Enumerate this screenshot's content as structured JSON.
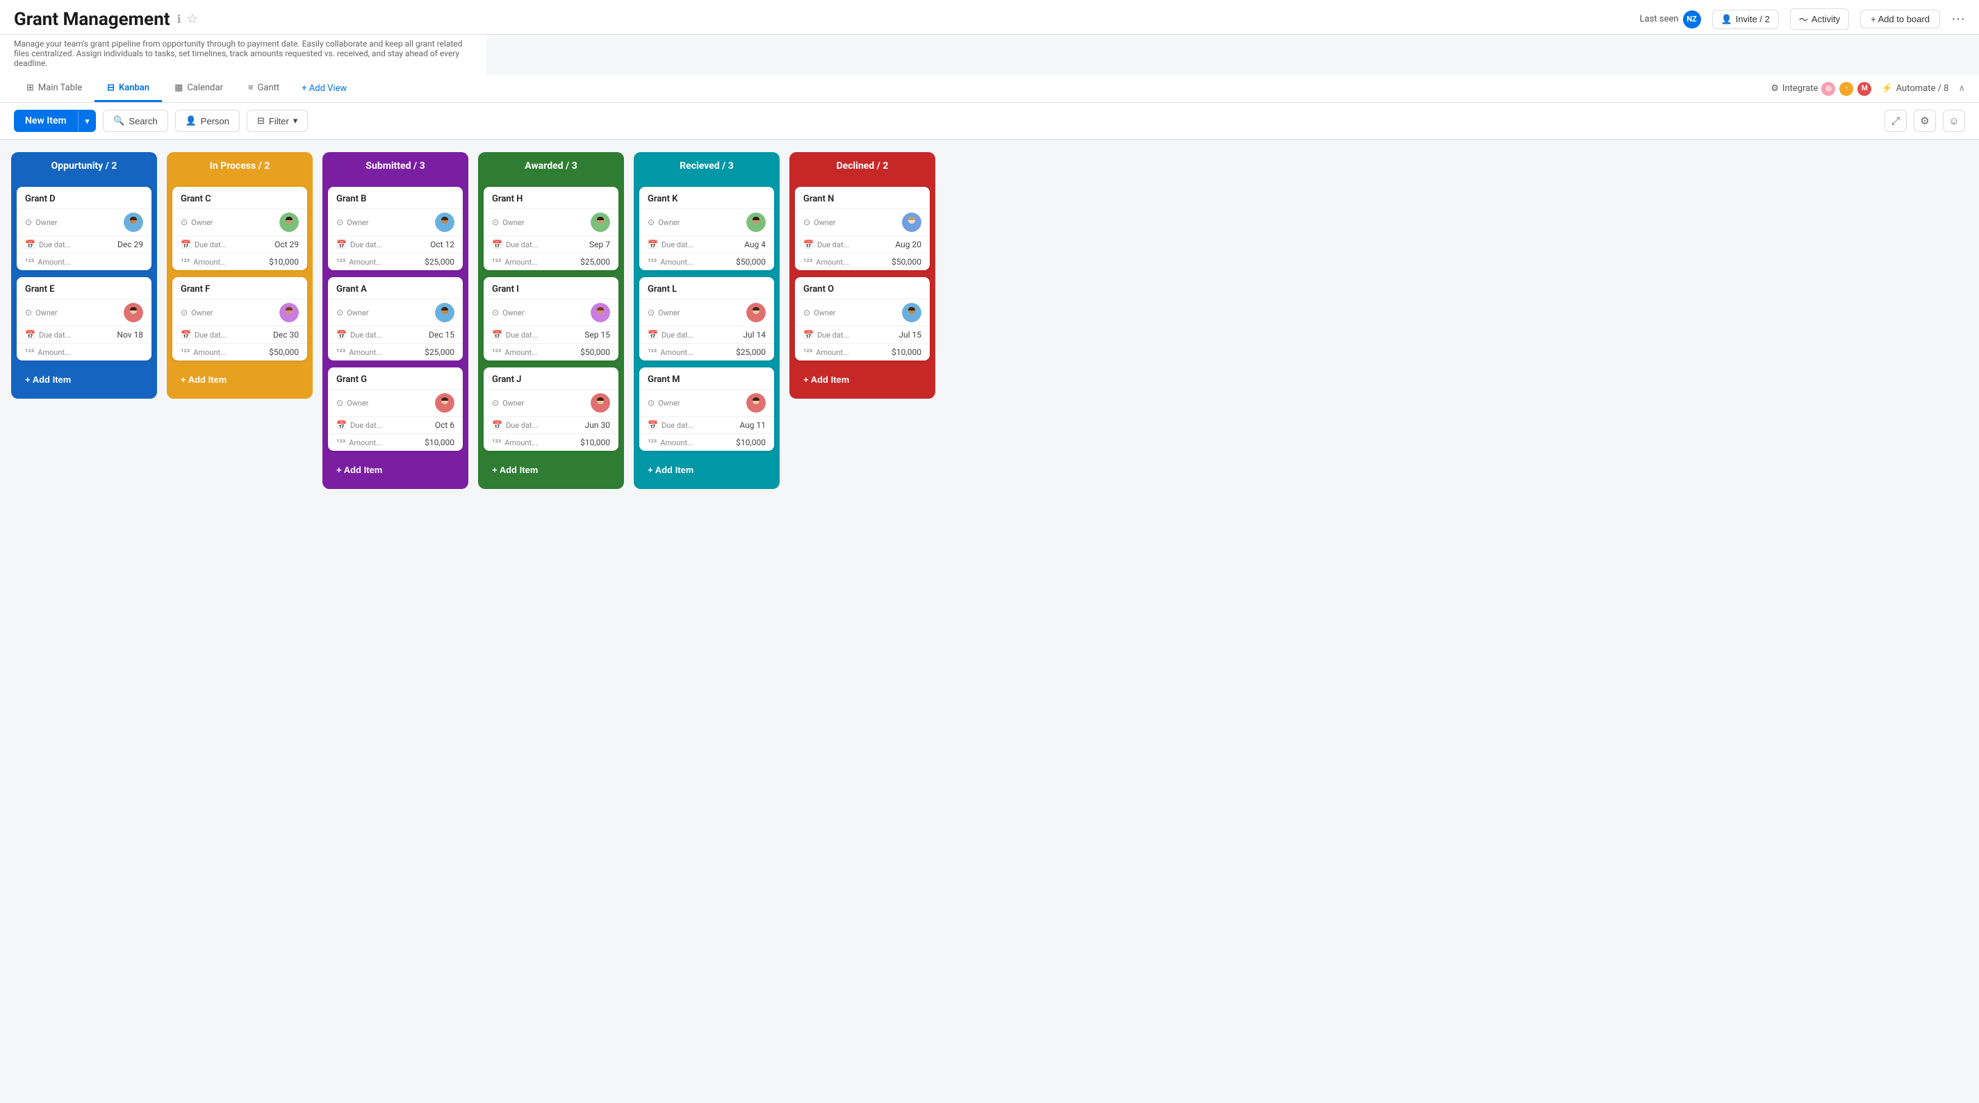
{
  "header": {
    "title": "Grant Management",
    "info_icon": "ℹ",
    "star_icon": "☆",
    "subtitle": "Manage your team's grant pipeline from opportunity through to payment date. Easily collaborate and keep all grant related files centralized. Assign individuals to tasks, set timelines, track amounts requested vs. received, and stay ahead of every deadline.",
    "last_seen_label": "Last seen",
    "last_seen_avatar": "NZ",
    "invite_label": "Invite / 2",
    "activity_label": "Activity",
    "add_to_board_label": "+ Add to board",
    "more_label": "···"
  },
  "tabs": {
    "items": [
      {
        "label": "Main Table",
        "icon": "⊞",
        "active": false
      },
      {
        "label": "Kanban",
        "icon": "⊟",
        "active": true
      },
      {
        "label": "Calendar",
        "icon": "📅",
        "active": false
      },
      {
        "label": "Gantt",
        "icon": "📊",
        "active": false
      }
    ],
    "add_view": "+ Add View",
    "integrate": "Integrate",
    "automate": "Automate / 8",
    "collapse": "∧"
  },
  "toolbar": {
    "new_item_label": "New Item",
    "search_label": "Search",
    "person_label": "Person",
    "filter_label": "Filter"
  },
  "columns": [
    {
      "id": "opportunity",
      "title": "Oppurtunity / 2",
      "color_class": "col-blue",
      "cards": [
        {
          "title": "Grant D",
          "owner_avatar": "male1",
          "due_date": "Dec 29",
          "amount": ""
        },
        {
          "title": "Grant E",
          "owner_avatar": "female1",
          "due_date": "Nov 18",
          "amount": ""
        }
      ],
      "add_label": "+ Add Item"
    },
    {
      "id": "in-process",
      "title": "In Process / 2",
      "color_class": "col-orange",
      "cards": [
        {
          "title": "Grant C",
          "owner_avatar": "male2",
          "due_date": "Oct 29",
          "amount": "$10,000"
        },
        {
          "title": "Grant F",
          "owner_avatar": "female2",
          "due_date": "Dec 30",
          "amount": "$50,000"
        }
      ],
      "add_label": "+ Add Item"
    },
    {
      "id": "submitted",
      "title": "Submitted / 3",
      "color_class": "col-purple",
      "cards": [
        {
          "title": "Grant B",
          "owner_avatar": "male1",
          "due_date": "Oct 12",
          "amount": "$25,000"
        },
        {
          "title": "Grant A",
          "owner_avatar": "male1",
          "due_date": "Dec 15",
          "amount": "$25,000"
        },
        {
          "title": "Grant G",
          "owner_avatar": "female1",
          "due_date": "Oct 6",
          "amount": "$10,000"
        }
      ],
      "add_label": "+ Add Item"
    },
    {
      "id": "awarded",
      "title": "Awarded / 3",
      "color_class": "col-green",
      "cards": [
        {
          "title": "Grant H",
          "owner_avatar": "male2",
          "due_date": "Sep 7",
          "amount": "$25,000"
        },
        {
          "title": "Grant I",
          "owner_avatar": "female2",
          "due_date": "Sep 15",
          "amount": "$50,000"
        },
        {
          "title": "Grant J",
          "owner_avatar": "female1",
          "due_date": "Jun 30",
          "amount": "$10,000"
        }
      ],
      "add_label": "+ Add Item"
    },
    {
      "id": "received",
      "title": "Recieved / 3",
      "color_class": "col-cyan",
      "cards": [
        {
          "title": "Grant K",
          "owner_avatar": "male2",
          "due_date": "Aug 4",
          "amount": "$50,000"
        },
        {
          "title": "Grant L",
          "owner_avatar": "female1",
          "due_date": "Jul 14",
          "amount": "$25,000"
        },
        {
          "title": "Grant M",
          "owner_avatar": "female1",
          "due_date": "Aug 11",
          "amount": "$10,000"
        }
      ],
      "add_label": "+ Add Item"
    },
    {
      "id": "declined",
      "title": "Declined / 2",
      "color_class": "col-red",
      "cards": [
        {
          "title": "Grant N",
          "owner_avatar": "female3",
          "due_date": "Aug 20",
          "amount": "$50,000"
        },
        {
          "title": "Grant O",
          "owner_avatar": "male1",
          "due_date": "Jul 15",
          "amount": "$10,000"
        }
      ],
      "add_label": "+ Add Item"
    }
  ],
  "labels": {
    "owner": "Owner",
    "due_date": "Due dat...",
    "amount": "Amount..."
  }
}
